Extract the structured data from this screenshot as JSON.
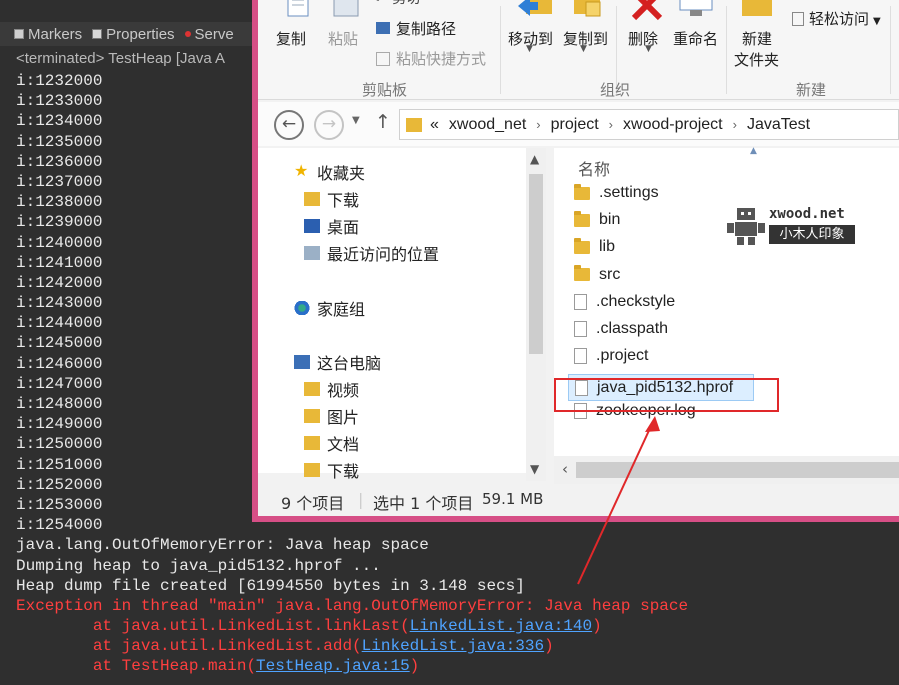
{
  "console": {
    "tabs": [
      {
        "label": "Markers"
      },
      {
        "label": "Properties"
      },
      {
        "label": "Serve"
      }
    ],
    "status": "<terminated> TestHeap [Java A",
    "iteration_lines": [
      "i:1232000",
      "i:1233000",
      "i:1234000",
      "i:1235000",
      "i:1236000",
      "i:1237000",
      "i:1238000",
      "i:1239000",
      "i:1240000",
      "i:1241000",
      "i:1242000",
      "i:1243000",
      "i:1244000",
      "i:1245000",
      "i:1246000",
      "i:1247000",
      "i:1248000",
      "i:1249000",
      "i:1250000",
      "i:1251000",
      "i:1252000",
      "i:1253000",
      "i:1254000"
    ],
    "oom_line": "java.lang.OutOfMemoryError: Java heap space",
    "dumping_line": "Dumping heap to java_pid5132.hprof ...",
    "dump_created_line": "Heap dump file created [61994550 bytes in 3.148 secs]",
    "exception_line": "Exception in thread \"main\" java.lang.OutOfMemoryError: Java heap space",
    "stack": [
      {
        "prefix": "        at java.util.LinkedList.linkLast(",
        "link": "LinkedList.java:140",
        "suffix": ")"
      },
      {
        "prefix": "        at java.util.LinkedList.add(",
        "link": "LinkedList.java:336",
        "suffix": ")"
      },
      {
        "prefix": "        at TestHeap.main(",
        "link": "TestHeap.java:15",
        "suffix": ")"
      }
    ]
  },
  "explorer": {
    "ribbon": {
      "copy": "复制",
      "paste": "粘贴",
      "cut": "剪切",
      "copy_path": "复制路径",
      "paste_shortcut": "粘贴快捷方式",
      "move_to": "移动到",
      "copy_to": "复制到",
      "delete": "删除",
      "rename": "重命名",
      "new_folder": "新建\n文件夹",
      "new_folder_l1": "新建",
      "new_folder_l2": "文件夹",
      "easy_access": "轻松访问",
      "group_clipboard": "剪贴板",
      "group_organize": "组织",
      "group_new": "新建"
    },
    "address": {
      "overflow": "«",
      "segments": [
        "xwood_net",
        "project",
        "xwood-project",
        "JavaTest"
      ]
    },
    "nav_items": {
      "favorites": "收藏夹",
      "downloads": "下载",
      "desktop": "桌面",
      "recent": "最近访问的位置",
      "homegroup": "家庭组",
      "this_pc": "这台电脑",
      "videos": "视频",
      "pictures": "图片",
      "documents": "文档",
      "downloads2": "下载"
    },
    "column_name": "名称",
    "files": [
      {
        "name": ".settings",
        "kind": "folder"
      },
      {
        "name": "bin",
        "kind": "folder"
      },
      {
        "name": "lib",
        "kind": "folder"
      },
      {
        "name": "src",
        "kind": "folder"
      },
      {
        "name": ".checkstyle",
        "kind": "file"
      },
      {
        "name": ".classpath",
        "kind": "file"
      },
      {
        "name": ".project",
        "kind": "file"
      },
      {
        "name": "java_pid5132.hprof",
        "kind": "file",
        "selected": true
      },
      {
        "name": "zookeeper.log",
        "kind": "file"
      }
    ],
    "status": {
      "item_count": "9 个项目",
      "selected": "选中 1 个项目",
      "size": "59.1 MB"
    },
    "watermark": {
      "site": "xwood.net",
      "subtitle": "小木人印象"
    }
  },
  "colors": {
    "window_frame": "#d64f86",
    "error_text": "#ff3f3f",
    "link_text": "#4fa3ff",
    "highlight_box": "#e0282a"
  }
}
